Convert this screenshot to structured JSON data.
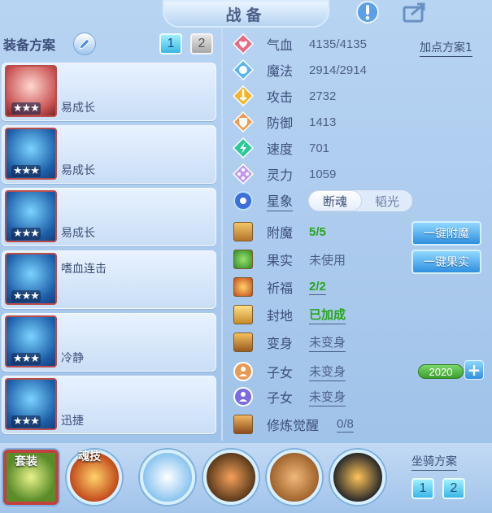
{
  "header": {
    "title": "战备"
  },
  "left": {
    "scheme_label": "装备方案",
    "scheme_buttons": [
      "1",
      "2"
    ],
    "equipment": [
      {
        "name": "易成长",
        "stars": "★★★"
      },
      {
        "name": "易成长",
        "stars": "★★★"
      },
      {
        "name": "易成长",
        "stars": "★★★"
      },
      {
        "name": "嗜血连击",
        "stars": "★★★"
      },
      {
        "name": "冷静",
        "stars": "★★★"
      },
      {
        "name": "迅捷",
        "stars": "★★★"
      }
    ]
  },
  "stats": {
    "hp_label": "气血",
    "hp_value": "4135/4135",
    "mp_label": "魔法",
    "mp_value": "2914/2914",
    "atk_label": "攻击",
    "atk_value": "2732",
    "def_label": "防御",
    "def_value": "1413",
    "spd_label": "速度",
    "spd_value": "701",
    "spirit_label": "灵力",
    "spirit_value": "1059",
    "point_plan_label": "加点方案1",
    "star_label": "星象",
    "star_options": [
      "断魂",
      "韬光"
    ]
  },
  "extras": {
    "enchant_label": "附魔",
    "enchant_value": "5/5",
    "enchant_button": "一键附魔",
    "fruit_label": "果实",
    "fruit_value": "未使用",
    "fruit_button": "一键果实",
    "bless_label": "祈福",
    "bless_value": "2/2",
    "seal_label": "封地",
    "seal_value": "已加成",
    "transform_label": "变身",
    "transform_value": "未变身",
    "child1_label": "子女",
    "child1_value": "未变身",
    "child1_level": "2020",
    "child2_label": "子女",
    "child2_value": "未变身",
    "cultivate_label": "修炼觉醒",
    "cultivate_value": "0/8"
  },
  "bottom": {
    "set_label": "套装",
    "soul_label": "魂技",
    "mount_label": "坐骑方案",
    "mount_buttons": [
      "1",
      "2"
    ]
  }
}
